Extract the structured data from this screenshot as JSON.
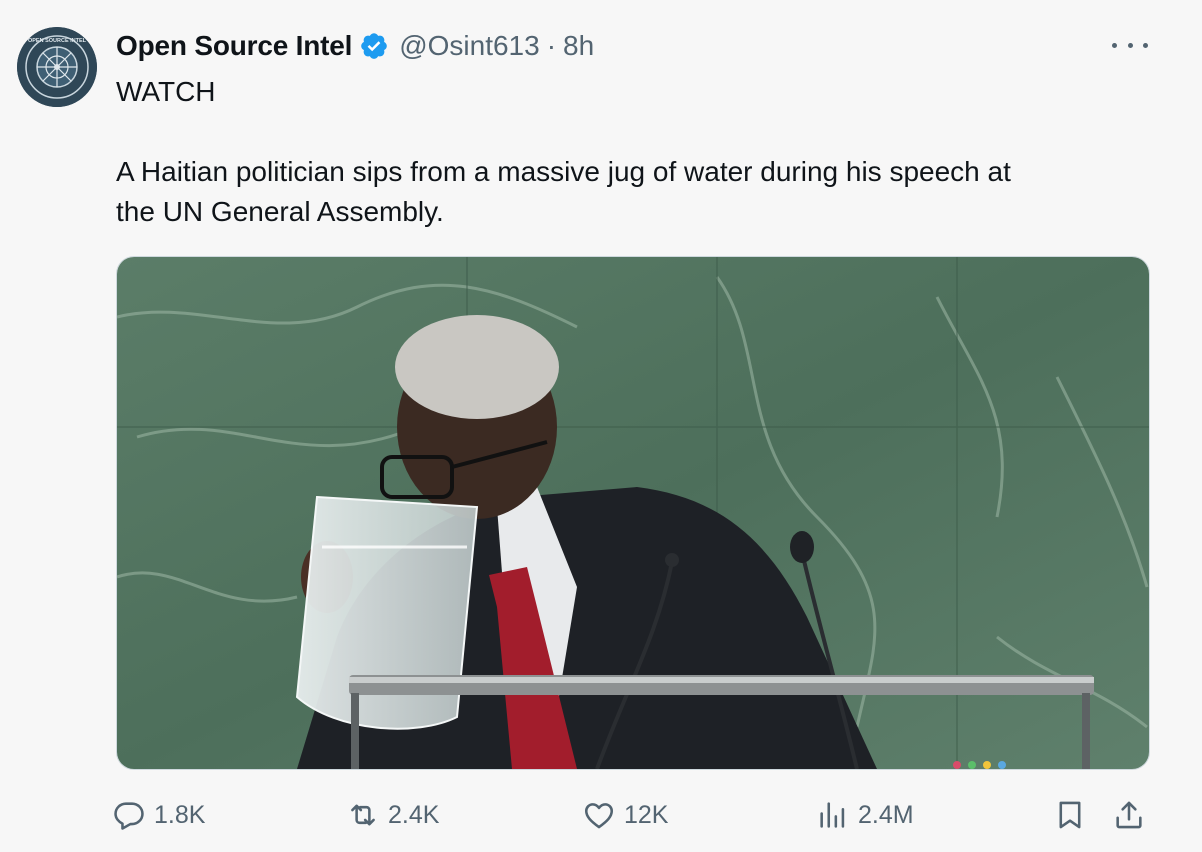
{
  "tweet": {
    "author_name": "Open Source Intel",
    "handle": "@Osint613",
    "separator": "·",
    "time_ago": "8h",
    "lines": [
      "WATCH",
      "A Haitian politician sips from a massive jug of water during his speech at",
      "the UN General Assembly."
    ],
    "avatar_text": "OPEN SOURCE INTEL",
    "media_icon": "video-still"
  },
  "actions": {
    "reply": {
      "count": "1.8K",
      "icon": "reply-icon"
    },
    "repost": {
      "count": "2.4K",
      "icon": "repost-icon"
    },
    "like": {
      "count": "12K",
      "icon": "like-icon"
    },
    "views": {
      "count": "2.4M",
      "icon": "views-icon"
    },
    "bookmark": {
      "icon": "bookmark-icon"
    },
    "share": {
      "icon": "share-icon"
    }
  },
  "colors": {
    "background": "#f7f7f7",
    "text": "#0f1419",
    "secondary": "#536471",
    "verified": "#1d9bf0",
    "avatar": "#2f4757"
  }
}
